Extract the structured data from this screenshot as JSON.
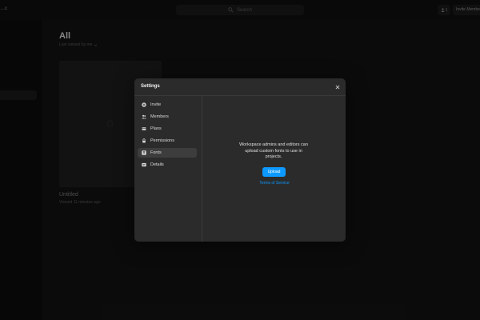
{
  "header": {
    "team_label": "…c",
    "search_placeholder": "Search",
    "seat_count": "1",
    "invite_label": "Invite Members"
  },
  "main": {
    "title": "All",
    "sort_label": "Last viewed by me",
    "file": {
      "name": "Untitled",
      "meta": "Viewed 11 minutes ago"
    }
  },
  "modal": {
    "title": "Settings",
    "nav": [
      {
        "label": "Invite",
        "icon": "plus-circle-icon"
      },
      {
        "label": "Members",
        "icon": "members-icon"
      },
      {
        "label": "Plans",
        "icon": "plans-icon"
      },
      {
        "label": "Permissions",
        "icon": "lock-icon"
      },
      {
        "label": "Fonts",
        "icon": "font-icon",
        "active": true
      },
      {
        "label": "Details",
        "icon": "details-icon"
      }
    ],
    "fonts": {
      "description": "Workspace admins and editors can upload custom fonts to use in projects.",
      "upload_label": "Upload",
      "terms_label": "Terms of Service"
    }
  },
  "colors": {
    "accent": "#0d99ff",
    "modal_bg": "#2b2b2b",
    "page_bg": "#121212"
  }
}
